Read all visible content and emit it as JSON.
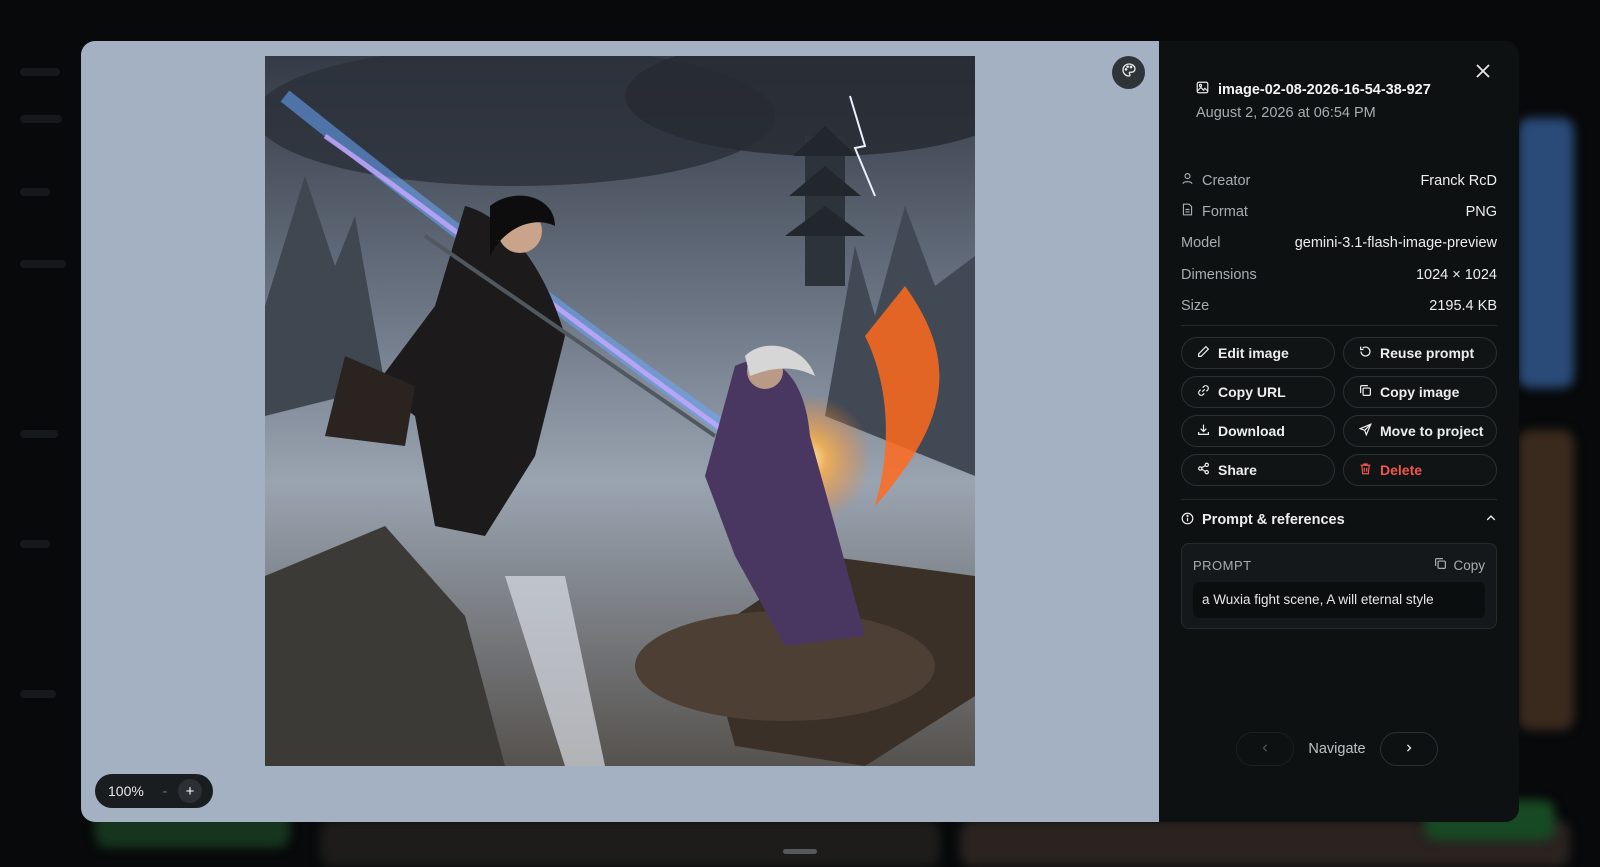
{
  "viewer": {
    "zoom_value": "100%",
    "zoom_out_label": "-",
    "zoom_in_label": "+",
    "palette_icon": "palette-icon",
    "image_alt": "a Wuxia fight scene, A will eternal style"
  },
  "panel": {
    "file_name": "image-02-08-2026-16-54-38-927",
    "date": "August 2, 2026 at 06:54 PM",
    "meta": {
      "creator_label": "Creator",
      "creator_value": "Franck RcD",
      "format_label": "Format",
      "format_value": "PNG",
      "model_label": "Model",
      "model_value": "gemini-3.1-flash-image-preview",
      "dimensions_label": "Dimensions",
      "dimensions_value": "1024 × 1024",
      "size_label": "Size",
      "size_value": "2195.4 KB"
    },
    "actions": {
      "edit_image": "Edit image",
      "reuse_prompt": "Reuse prompt",
      "copy_url": "Copy URL",
      "copy_image": "Copy image",
      "download": "Download",
      "move_to_project": "Move to project",
      "share": "Share",
      "delete": "Delete"
    },
    "prompt_section": {
      "title": "Prompt & references",
      "prompt_label": "PROMPT",
      "copy_label": "Copy",
      "prompt_text": "a Wuxia fight scene, A will eternal style"
    },
    "navigation": {
      "label": "Navigate"
    }
  },
  "colors": {
    "viewer_bg": "#a4b1c3",
    "panel_bg": "#0e1112",
    "danger": "#f0574f"
  }
}
